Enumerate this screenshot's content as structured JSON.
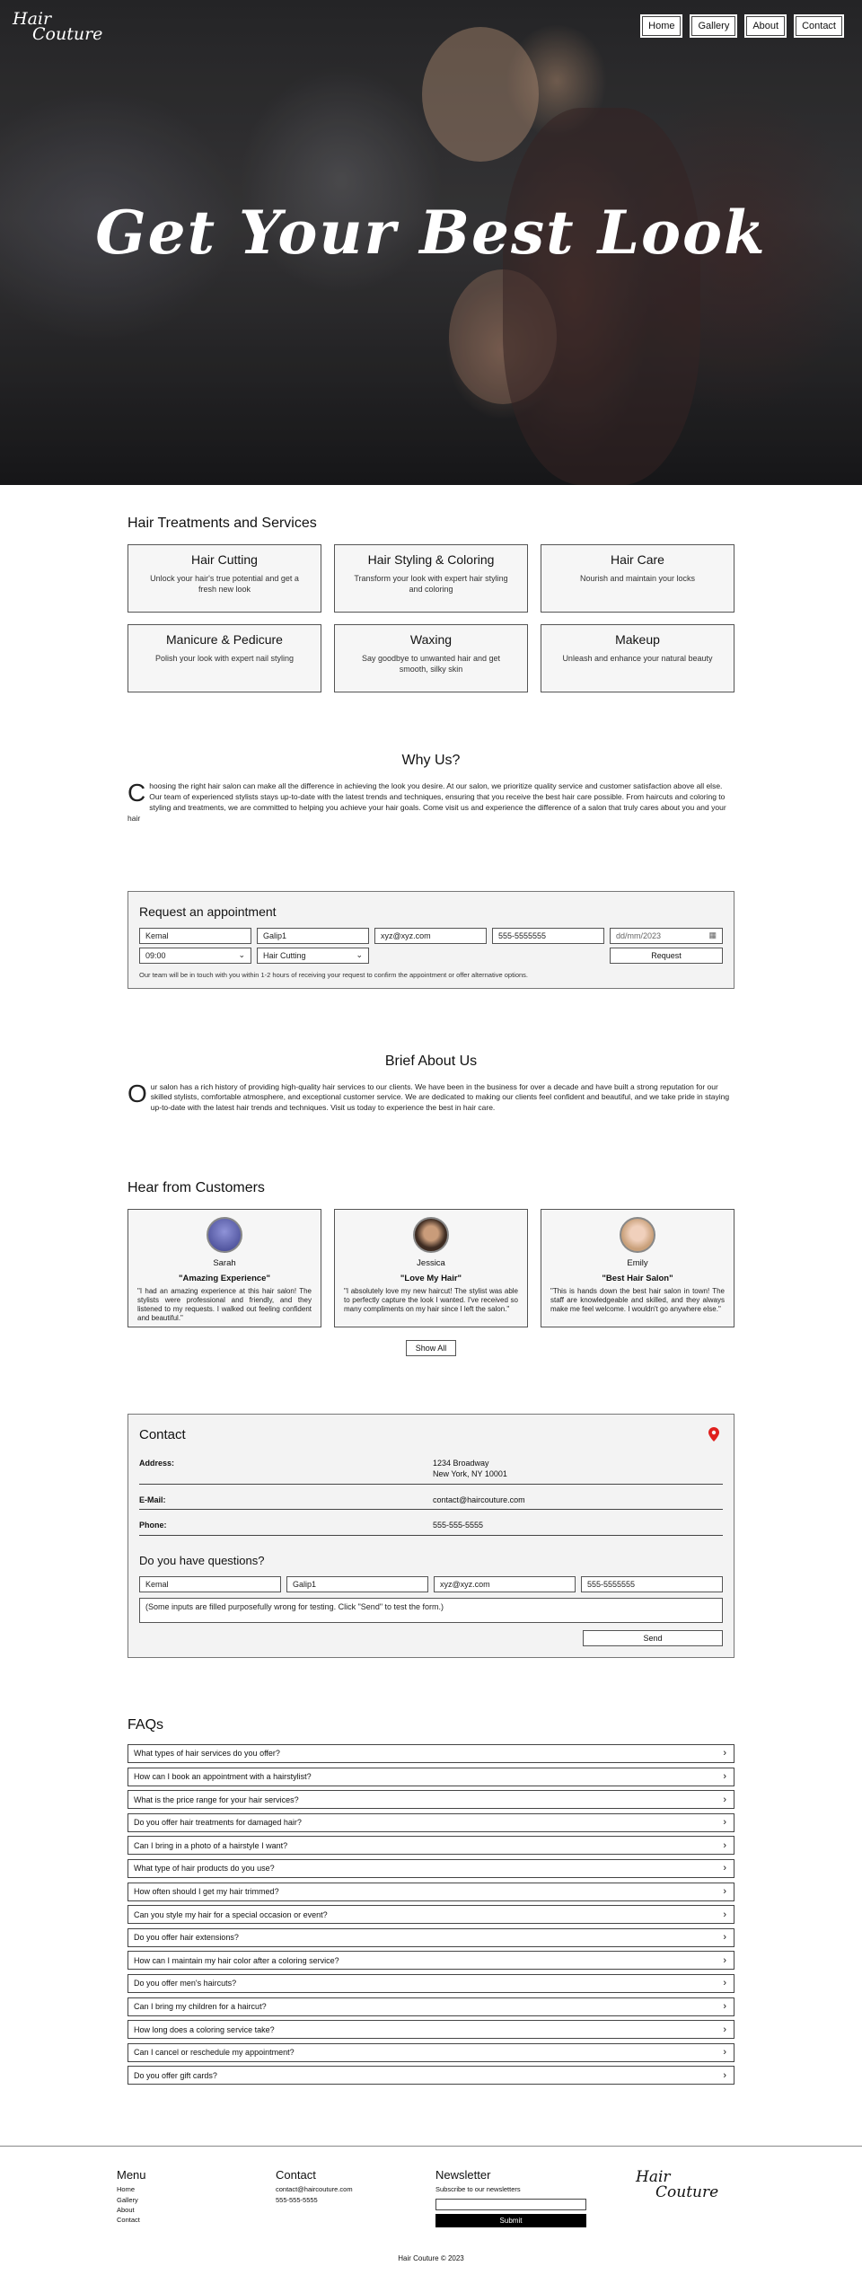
{
  "header": {
    "logo_line1": "Hair",
    "logo_line2": "Couture",
    "nav": [
      "Home",
      "Gallery",
      "About",
      "Contact"
    ],
    "hero_title": "Get Your Best Look"
  },
  "services": {
    "title": "Hair Treatments and Services",
    "items": [
      {
        "name": "Hair Cutting",
        "desc": "Unlock your hair's true potential and get a fresh new look"
      },
      {
        "name": "Hair Styling & Coloring",
        "desc": "Transform your look with expert hair styling and coloring"
      },
      {
        "name": "Hair Care",
        "desc": "Nourish and maintain your locks"
      },
      {
        "name": "Manicure & Pedicure",
        "desc": "Polish your look with expert nail styling"
      },
      {
        "name": "Waxing",
        "desc": "Say goodbye to unwanted hair and get smooth, silky skin"
      },
      {
        "name": "Makeup",
        "desc": "Unleash and enhance your natural beauty"
      }
    ]
  },
  "why": {
    "title": "Why Us?",
    "dropcap": "C",
    "text": "hoosing the right hair salon can make all the difference in achieving the look you desire. At our salon, we prioritize quality service and customer satisfaction above all else. Our team of experienced stylists stays up-to-date with the latest trends and techniques, ensuring that you receive the best hair care possible. From haircuts and coloring to styling and treatments, we are committed to helping you achieve your hair goals. Come visit us and experience the difference of a salon that truly cares about you and your hair"
  },
  "appointment": {
    "title": "Request an appointment",
    "first_name": "Kemal",
    "last_name": "Galip1",
    "email": "xyz@xyz.com",
    "phone": "555-5555555",
    "date_placeholder": "dd/mm/2023",
    "calendar_icon": "calendar-icon",
    "time": "09:00",
    "service": "Hair Cutting",
    "submit": "Request",
    "note": "Our team will be in touch with you within 1-2 hours of receiving your request to confirm the appointment or offer alternative options."
  },
  "about": {
    "title": "Brief About Us",
    "dropcap": "O",
    "text": "ur salon has a rich history of providing high-quality hair services to our clients. We have been in the business for over a decade and have built a strong reputation for our skilled stylists, comfortable atmosphere, and exceptional customer service. We are dedicated to making our clients feel confident and beautiful, and we take pride in staying up-to-date with the latest hair trends and techniques. Visit us today to experience the best in hair care."
  },
  "testimonials": {
    "title": "Hear from Customers",
    "items": [
      {
        "name": "Sarah",
        "headline": "\"Amazing Experience\"",
        "text": "\"I had an amazing experience at this hair salon! The stylists were professional and friendly, and they listened to my requests. I walked out feeling confident and beautiful.\"",
        "color": "#5a63b8"
      },
      {
        "name": "Jessica",
        "headline": "\"Love My Hair\"",
        "text": "\"I absolutely love my new haircut! The stylist was able to perfectly capture the look I wanted. I've received so many compliments on my hair since I left the salon.\"",
        "color": "#5b4636"
      },
      {
        "name": "Emily",
        "headline": "\"Best Hair Salon\"",
        "text": "\"This is hands down the best hair salon in town! The staff are knowledgeable and skilled, and they always make me feel welcome. I wouldn't go anywhere else.\"",
        "color": "#d9b8a0"
      }
    ],
    "show_all": "Show All"
  },
  "contact": {
    "title": "Contact",
    "pin_icon": "location-pin-icon",
    "address_label": "Address:",
    "address_line1": "1234 Broadway",
    "address_line2": "New York, NY 10001",
    "email_label": "E-Mail:",
    "email": "contact@haircouture.com",
    "phone_label": "Phone:",
    "phone": "555-555-5555",
    "questions_title": "Do you have questions?",
    "first_name": "Kemal",
    "last_name": "Galip1",
    "q_email": "xyz@xyz.com",
    "q_phone": "555-5555555",
    "message": "(Some inputs are filled purposefully wrong for testing. Click \"Send\" to test the form.)",
    "send": "Send",
    "accent": "#e0201e"
  },
  "faq": {
    "title": "FAQs",
    "chevron_icon": "chevron-right-icon",
    "items": [
      "What types of hair services do you offer?",
      "How can I book an appointment with a hairstylist?",
      "What is the price range for your hair services?",
      "Do you offer hair treatments for damaged hair?",
      "Can I bring in a photo of a hairstyle I want?",
      "What type of hair products do you use?",
      "How often should I get my hair trimmed?",
      "Can you style my hair for a special occasion or event?",
      "Do you offer hair extensions?",
      "How can I maintain my hair color after a coloring service?",
      "Do you offer men's haircuts?",
      "Can I bring my children for a haircut?",
      "How long does a coloring service take?",
      "Can I cancel or reschedule my appointment?",
      "Do you offer gift cards?"
    ]
  },
  "footer": {
    "menu_title": "Menu",
    "menu": [
      "Home",
      "Gallery",
      "About",
      "Contact"
    ],
    "contact_title": "Contact",
    "contact_email": "contact@haircouture.com",
    "contact_phone": "555-555-5555",
    "newsletter_title": "Newsletter",
    "newsletter_sub": "Subscribe to our newsletters",
    "submit": "Submit",
    "logo_line1": "Hair",
    "logo_line2": "Couture",
    "copyright": "Hair Couture © 2023"
  }
}
